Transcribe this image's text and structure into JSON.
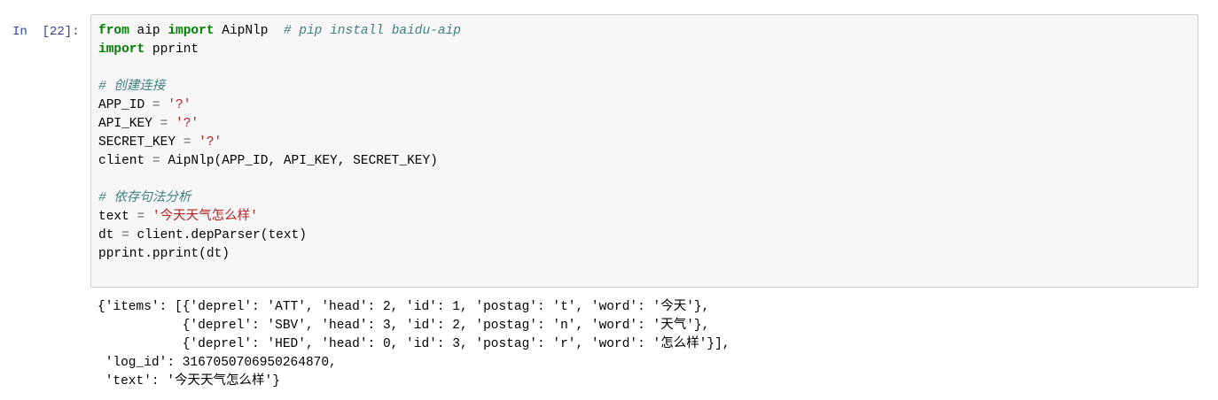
{
  "cell": {
    "prompt": "In  [22]:",
    "code": {
      "l1": {
        "kw1": "from",
        "mod": " aip ",
        "kw2": "import",
        "name": " AipNlp  ",
        "comment": "# pip install baidu-aip"
      },
      "l2": {
        "kw": "import",
        "rest": " pprint"
      },
      "l4": {
        "comment": "# 创建连接"
      },
      "l5": {
        "name": "APP_ID ",
        "op": "=",
        "sp": " ",
        "str": "'?'"
      },
      "l6": {
        "name": "API_KEY ",
        "op": "=",
        "sp": " ",
        "str": "'?'"
      },
      "l7": {
        "name": "SECRET_KEY ",
        "op": "=",
        "sp": " ",
        "str": "'?'"
      },
      "l8": {
        "name": "client ",
        "op": "=",
        "rest": " AipNlp(APP_ID, API_KEY, SECRET_KEY)"
      },
      "l10": {
        "comment": "# 依存句法分析"
      },
      "l11": {
        "name": "text ",
        "op": "=",
        "sp": " ",
        "str": "'今天天气怎么样'"
      },
      "l12": {
        "name": "dt ",
        "op": "=",
        "rest": " client.depParser(text)"
      },
      "l13": {
        "text": "pprint.pprint(dt)"
      }
    }
  },
  "output": {
    "lines": [
      "{'items': [{'deprel': 'ATT', 'head': 2, 'id': 1, 'postag': 't', 'word': '今天'},",
      "           {'deprel': 'SBV', 'head': 3, 'id': 2, 'postag': 'n', 'word': '天气'},",
      "           {'deprel': 'HED', 'head': 0, 'id': 3, 'postag': 'r', 'word': '怎么样'}],",
      " 'log_id': 3167050706950264870,",
      " 'text': '今天天气怎么样'}"
    ]
  }
}
